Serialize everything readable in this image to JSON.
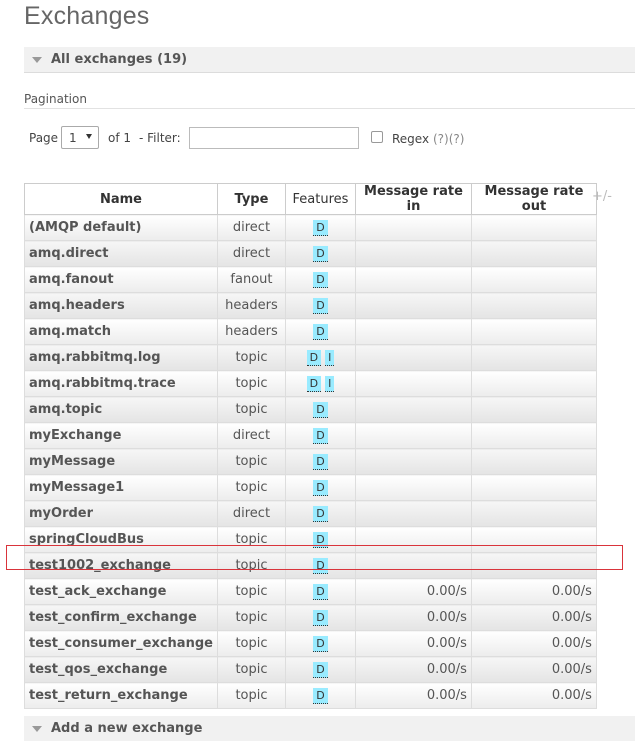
{
  "page": {
    "title": "Exchanges"
  },
  "sections": {
    "all_exchanges": "All exchanges (19)",
    "add_exchange": "Add a new exchange"
  },
  "pagination": {
    "label": "Pagination",
    "page_label": "Page",
    "page_value": "1",
    "of_label": "of 1",
    "filter_label": "- Filter:",
    "filter_value": "",
    "regex_label": "Regex",
    "regex_help": "(?)(?)",
    "regex_checked": false
  },
  "table": {
    "headers": [
      "Name",
      "Type",
      "Features",
      "Message rate in",
      "Message rate out"
    ],
    "toggle_columns": "+/-",
    "rows": [
      {
        "name": "(AMQP default)",
        "type": "direct",
        "features": [
          "D"
        ],
        "rate_in": "",
        "rate_out": ""
      },
      {
        "name": "amq.direct",
        "type": "direct",
        "features": [
          "D"
        ],
        "rate_in": "",
        "rate_out": ""
      },
      {
        "name": "amq.fanout",
        "type": "fanout",
        "features": [
          "D"
        ],
        "rate_in": "",
        "rate_out": ""
      },
      {
        "name": "amq.headers",
        "type": "headers",
        "features": [
          "D"
        ],
        "rate_in": "",
        "rate_out": ""
      },
      {
        "name": "amq.match",
        "type": "headers",
        "features": [
          "D"
        ],
        "rate_in": "",
        "rate_out": ""
      },
      {
        "name": "amq.rabbitmq.log",
        "type": "topic",
        "features": [
          "D",
          "I"
        ],
        "rate_in": "",
        "rate_out": ""
      },
      {
        "name": "amq.rabbitmq.trace",
        "type": "topic",
        "features": [
          "D",
          "I"
        ],
        "rate_in": "",
        "rate_out": ""
      },
      {
        "name": "amq.topic",
        "type": "topic",
        "features": [
          "D"
        ],
        "rate_in": "",
        "rate_out": ""
      },
      {
        "name": "myExchange",
        "type": "direct",
        "features": [
          "D"
        ],
        "rate_in": "",
        "rate_out": ""
      },
      {
        "name": "myMessage",
        "type": "topic",
        "features": [
          "D"
        ],
        "rate_in": "",
        "rate_out": ""
      },
      {
        "name": "myMessage1",
        "type": "topic",
        "features": [
          "D"
        ],
        "rate_in": "",
        "rate_out": ""
      },
      {
        "name": "myOrder",
        "type": "direct",
        "features": [
          "D"
        ],
        "rate_in": "",
        "rate_out": ""
      },
      {
        "name": "springCloudBus",
        "type": "topic",
        "features": [
          "D"
        ],
        "rate_in": "",
        "rate_out": ""
      },
      {
        "name": "test1002_exchange",
        "type": "topic",
        "features": [
          "D"
        ],
        "rate_in": "",
        "rate_out": ""
      },
      {
        "name": "test_ack_exchange",
        "type": "topic",
        "features": [
          "D"
        ],
        "rate_in": "0.00/s",
        "rate_out": "0.00/s"
      },
      {
        "name": "test_confirm_exchange",
        "type": "topic",
        "features": [
          "D"
        ],
        "rate_in": "0.00/s",
        "rate_out": "0.00/s"
      },
      {
        "name": "test_consumer_exchange",
        "type": "topic",
        "features": [
          "D"
        ],
        "rate_in": "0.00/s",
        "rate_out": "0.00/s"
      },
      {
        "name": "test_qos_exchange",
        "type": "topic",
        "features": [
          "D"
        ],
        "rate_in": "0.00/s",
        "rate_out": "0.00/s"
      },
      {
        "name": "test_return_exchange",
        "type": "topic",
        "features": [
          "D"
        ],
        "rate_in": "0.00/s",
        "rate_out": "0.00/s"
      }
    ]
  },
  "colors": {
    "highlight": "#d9343b",
    "feature_badge": "#99ebff"
  }
}
